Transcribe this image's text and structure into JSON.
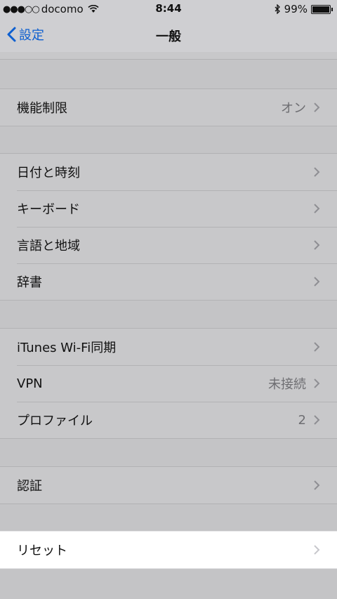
{
  "status_bar": {
    "signal": "●●●○○",
    "carrier": "docomo",
    "time": "8:44",
    "battery_percent": "99%",
    "battery_level": 0.99
  },
  "nav": {
    "back_label": "設定",
    "title": "一般"
  },
  "groups": [
    {
      "rows": [
        {
          "label": "機能制限",
          "value": "オン"
        }
      ]
    },
    {
      "rows": [
        {
          "label": "日付と時刻",
          "value": ""
        },
        {
          "label": "キーボード",
          "value": ""
        },
        {
          "label": "言語と地域",
          "value": ""
        },
        {
          "label": "辞書",
          "value": ""
        }
      ]
    },
    {
      "rows": [
        {
          "label": "iTunes Wi-Fi同期",
          "value": ""
        },
        {
          "label": "VPN",
          "value": "未接続"
        },
        {
          "label": "プロファイル",
          "value": "2"
        }
      ]
    },
    {
      "rows": [
        {
          "label": "認証",
          "value": ""
        }
      ]
    },
    {
      "rows": [
        {
          "label": "リセット",
          "value": ""
        }
      ]
    }
  ],
  "colors": {
    "accent": "#0d5fd0",
    "dim_background": "#c4c4c6",
    "highlight_row": "#ffffff"
  }
}
